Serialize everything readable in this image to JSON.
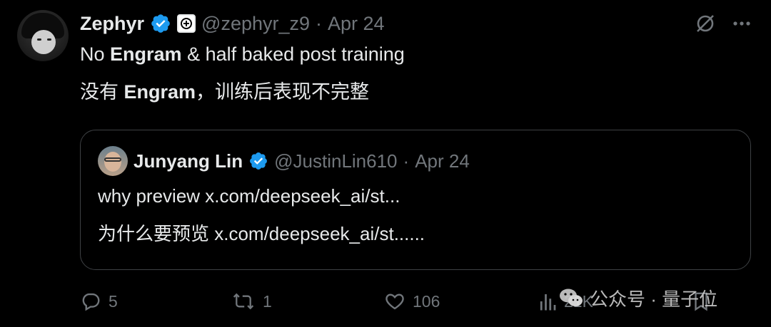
{
  "tweet": {
    "author_name": "Zephyr",
    "author_handle": "@zephyr_z9",
    "date_separator": "·",
    "date": "Apr 24",
    "text_en_pre": "No ",
    "text_en_bold": "Engram",
    "text_en_post": " & half baked post training",
    "text_zh_pre": "没有 ",
    "text_zh_bold": "Engram",
    "text_zh_post": "，训练后表现不完整"
  },
  "quoted_tweet": {
    "author_name": "Junyang Lin",
    "author_handle": "@JustinLin610",
    "date_separator": "·",
    "date": "Apr 24",
    "text_en": "why preview x.com/deepseek_ai/st...",
    "text_zh": "为什么要预览 x.com/deepseek_ai/st......"
  },
  "actions": {
    "reply_count": "5",
    "retweet_count": "1",
    "like_count": "106",
    "views_count": "21K"
  },
  "watermark": {
    "text": "公众号 · 量子位"
  },
  "icons": {
    "verified": "verified-badge-icon",
    "affiliation": "affiliation-badge-icon",
    "grok": "grok-icon",
    "more": "more-icon",
    "reply": "reply-icon",
    "retweet": "retweet-icon",
    "like": "heart-icon",
    "views": "views-icon",
    "bookmark": "bookmark-icon"
  },
  "colors": {
    "background": "#000000",
    "text": "#e7e9ea",
    "muted": "#71767b",
    "verified": "#1d9bf0",
    "border": "#3e4144"
  }
}
